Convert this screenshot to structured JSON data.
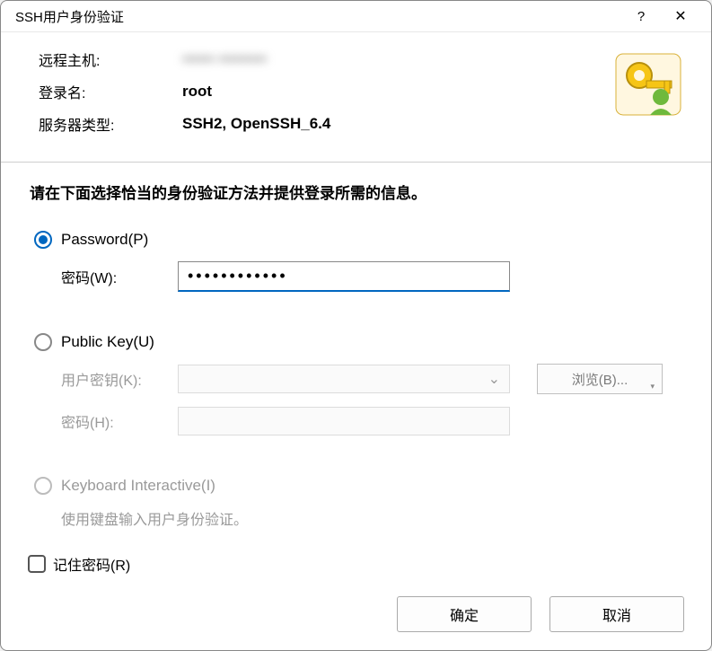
{
  "title": "SSH用户身份验证",
  "header": {
    "remote_host_label": "远程主机:",
    "remote_host_value": "••••••  •••••••••",
    "login_label": "登录名:",
    "login_value": "root",
    "server_type_label": "服务器类型:",
    "server_type_value": "SSH2, OpenSSH_6.4"
  },
  "instruction": "请在下面选择恰当的身份验证方法并提供登录所需的信息。",
  "method_password": {
    "label": "Password(P)",
    "password_label": "密码(W):",
    "password_value": "••••••••••••"
  },
  "method_publickey": {
    "label": "Public Key(U)",
    "userkey_label": "用户密钥(K):",
    "browse_label": "浏览(B)...",
    "password_label": "密码(H):"
  },
  "method_keyboard": {
    "label": "Keyboard Interactive(I)",
    "hint": "使用键盘输入用户身份验证。"
  },
  "remember_label": "记住密码(R)",
  "buttons": {
    "ok": "确定",
    "cancel": "取消"
  }
}
